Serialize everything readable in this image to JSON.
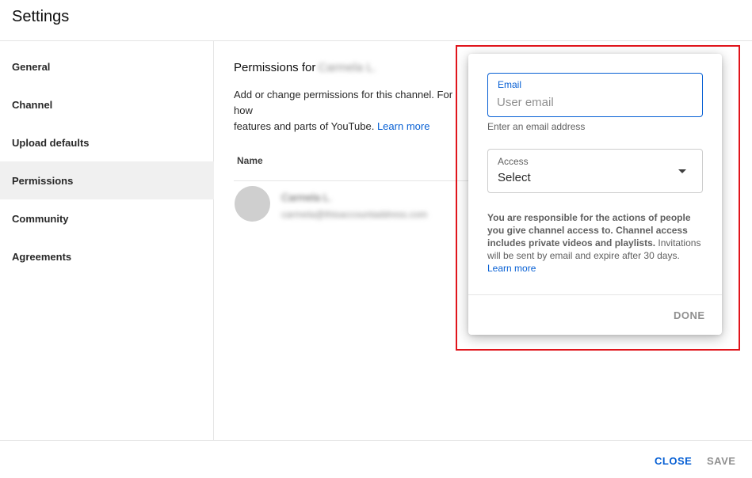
{
  "header": {
    "title": "Settings"
  },
  "sidebar": {
    "items": [
      {
        "label": "General"
      },
      {
        "label": "Channel"
      },
      {
        "label": "Upload defaults"
      },
      {
        "label": "Permissions"
      },
      {
        "label": "Community"
      },
      {
        "label": "Agreements"
      }
    ],
    "active": "Permissions"
  },
  "main": {
    "title_prefix": "Permissions for",
    "title_name": "Carmela L.",
    "description": "Add or change permissions for this channel. For how",
    "description_line2": "features and parts of YouTube.",
    "learn_more": "Learn more",
    "column_name": "Name",
    "user": {
      "name": "Carmela L.",
      "email": "carmela@thisaccountaddress.com"
    }
  },
  "dialog": {
    "email_label": "Email",
    "email_placeholder": "User email",
    "email_value": "",
    "email_help": "Enter an email address",
    "access_label": "Access",
    "access_value": "Select",
    "notice_bold": "You are responsible for the actions of people you give channel access to. Channel access includes private videos and playlists.",
    "notice_rest": " Invitations will be sent by email and expire after 30 days. ",
    "notice_link": "Learn more",
    "done_label": "DONE"
  },
  "footer": {
    "close_label": "CLOSE",
    "save_label": "SAVE"
  },
  "colors": {
    "accent": "#065fd4",
    "highlight": "#e0141b",
    "disabled": "#909090"
  }
}
